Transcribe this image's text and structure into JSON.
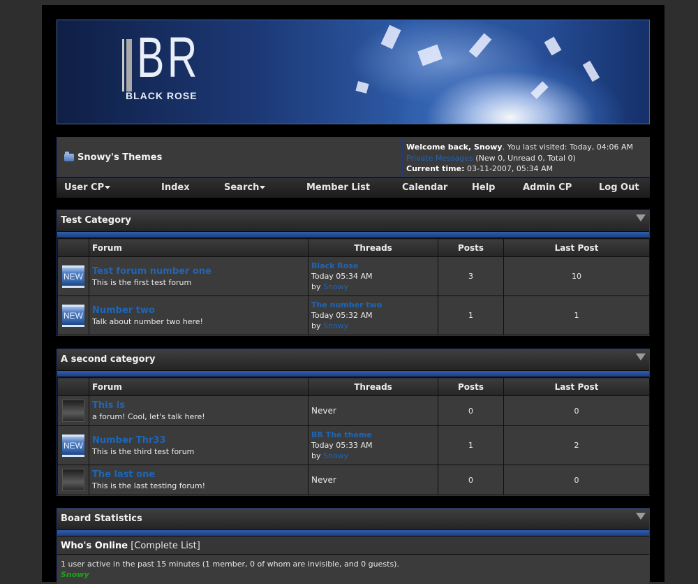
{
  "banner": {
    "logo_text": "BR",
    "logo_subtitle": "BLACK ROSE"
  },
  "header": {
    "site_name": "Snowy's Themes",
    "welcome_prefix": "Welcome back, Snowy",
    "last_visited": ". You last visited: Today, 04:06 AM",
    "pm_link": "Private Messages",
    "pm_counts": " (New 0, Unread 0, Total 0)",
    "current_time_label": "Current time:",
    "current_time_value": " 03-11-2007, 05:34 AM"
  },
  "nav": {
    "items": [
      "User CP",
      "Index",
      "Search",
      "Member List",
      "Calendar",
      "Help",
      "Admin CP",
      "Log Out"
    ]
  },
  "columns": {
    "forum": "Forum",
    "threads": "Threads",
    "posts": "Posts",
    "last_post": "Last Post"
  },
  "categories": [
    {
      "title": "Test Category",
      "forums": [
        {
          "status": "NEW",
          "name": "Test forum number one",
          "description": "This is the first test forum",
          "thread_title": "Black Rose",
          "thread_time": "Today 05:34 AM",
          "by": "by ",
          "thread_user": "Snowy",
          "posts": "3",
          "last_post": "10"
        },
        {
          "status": "NEW",
          "name": "Number two",
          "description": "Talk about number two here!",
          "thread_title": "The number two",
          "thread_time": "Today 05:32 AM",
          "by": "by ",
          "thread_user": "Snowy",
          "posts": "1",
          "last_post": "1"
        }
      ]
    },
    {
      "title": "A second category",
      "forums": [
        {
          "status": "",
          "name": "This is",
          "description": "a forum! Cool, let's talk here!",
          "never": "Never",
          "posts": "0",
          "last_post": "0"
        },
        {
          "status": "NEW",
          "name": "Number Thr33",
          "description": "This is the third test forum",
          "thread_title": "BR The theme",
          "thread_time": "Today 05:33 AM",
          "by": "by ",
          "thread_user": "Snowy",
          "posts": "1",
          "last_post": "2"
        },
        {
          "status": "",
          "name": "The last one",
          "description": "This is the last testing forum!",
          "never": "Never",
          "posts": "0",
          "last_post": "0"
        }
      ]
    }
  ],
  "stats": {
    "title": "Board Statistics",
    "whos_online": "Who's Online",
    "complete_list": " [Complete List]",
    "active_text": "1 user active in the past 15 minutes (1 member, 0 of whom are invisible, and 0 guests).",
    "online_user": "Snowy"
  },
  "colors": {
    "link": "#1d66b8",
    "accent": "#2f5fb0",
    "online": "#1aa51a"
  }
}
